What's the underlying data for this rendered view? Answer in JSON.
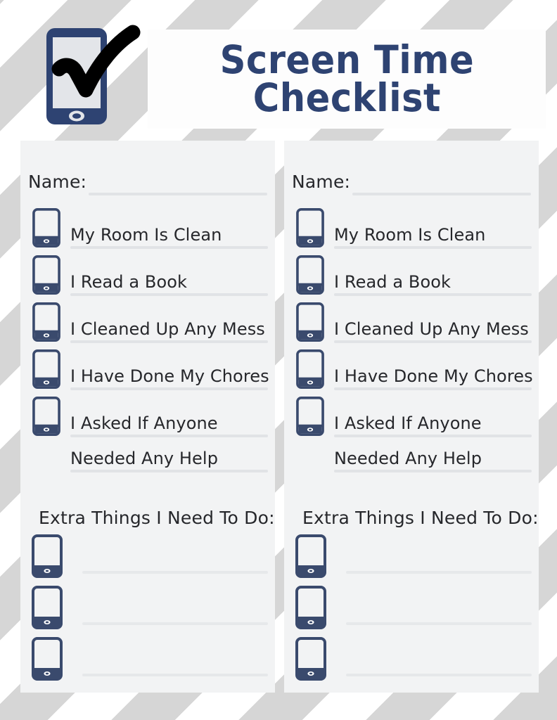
{
  "page": {
    "title_line1": "Screen Time",
    "title_line2": "Checklist",
    "title_full": "Screen Time\nChecklist",
    "logo_icon": "tablet-checkmark-icon",
    "colors": {
      "navy": "#2e4372",
      "card_background": "#f2f3f4",
      "banner_background": "#fdfdfd",
      "stripe_gray": "#d6d6d6",
      "stripe_white": "#ffffff",
      "text": "#26272b",
      "rule_line": "#e1e3e6",
      "checkmark": "#000000"
    }
  },
  "columns": [
    {
      "name_label": "Name:",
      "name_value": "",
      "items": [
        {
          "label": "My Room Is Clean",
          "checked": false,
          "icon": "tablet-checkbox-icon"
        },
        {
          "label": "I Read a Book",
          "checked": false,
          "icon": "tablet-checkbox-icon"
        },
        {
          "label": "I Cleaned Up Any Mess",
          "checked": false,
          "icon": "tablet-checkbox-icon"
        },
        {
          "label": "I Have Done My Chores",
          "checked": false,
          "icon": "tablet-checkbox-icon"
        },
        {
          "label": "I Asked If Anyone",
          "checked": false,
          "icon": "tablet-checkbox-icon"
        }
      ],
      "continuation": "Needed Any Help",
      "extra_heading": "Extra Things I Need To Do:",
      "extra_items": [
        {
          "value": "",
          "checked": false,
          "icon": "tablet-checkbox-icon"
        },
        {
          "value": "",
          "checked": false,
          "icon": "tablet-checkbox-icon"
        },
        {
          "value": "",
          "checked": false,
          "icon": "tablet-checkbox-icon"
        }
      ]
    },
    {
      "name_label": "Name:",
      "name_value": "",
      "items": [
        {
          "label": "My Room Is Clean",
          "checked": false,
          "icon": "tablet-checkbox-icon"
        },
        {
          "label": "I Read a Book",
          "checked": false,
          "icon": "tablet-checkbox-icon"
        },
        {
          "label": "I Cleaned Up Any Mess",
          "checked": false,
          "icon": "tablet-checkbox-icon"
        },
        {
          "label": "I Have Done My Chores",
          "checked": false,
          "icon": "tablet-checkbox-icon"
        },
        {
          "label": "I Asked If Anyone",
          "checked": false,
          "icon": "tablet-checkbox-icon"
        }
      ],
      "continuation": "Needed Any Help",
      "extra_heading": "Extra Things I Need To Do:",
      "extra_items": [
        {
          "value": "",
          "checked": false,
          "icon": "tablet-checkbox-icon"
        },
        {
          "value": "",
          "checked": false,
          "icon": "tablet-checkbox-icon"
        },
        {
          "value": "",
          "checked": false,
          "icon": "tablet-checkbox-icon"
        }
      ]
    }
  ]
}
